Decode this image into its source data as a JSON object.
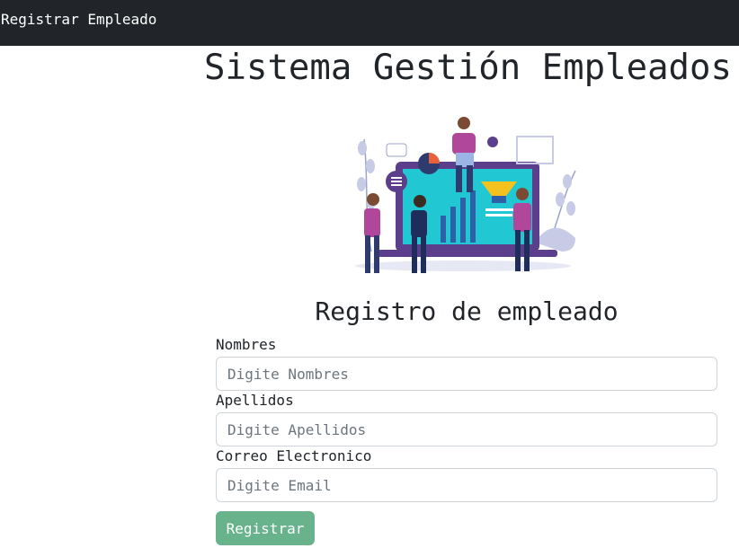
{
  "navbar": {
    "brand": "Registrar Empleado"
  },
  "page": {
    "title": "Sistema Gestión Empleados"
  },
  "form": {
    "title": "Registro de empleado",
    "fields": [
      {
        "label": "Nombres",
        "placeholder": "Digite Nombres",
        "value": ""
      },
      {
        "label": "Apellidos",
        "placeholder": "Digite Apellidos",
        "value": ""
      },
      {
        "label": "Correo Electronico",
        "placeholder": "Digite Email",
        "value": ""
      }
    ],
    "submit_label": "Registrar"
  },
  "illustration": {
    "icon": "team-analytics-illustration"
  },
  "colors": {
    "navbar_bg": "#212529",
    "button_bg": "#68b38c",
    "text": "#212529",
    "input_border": "#ced4da",
    "placeholder": "#6c757d"
  }
}
